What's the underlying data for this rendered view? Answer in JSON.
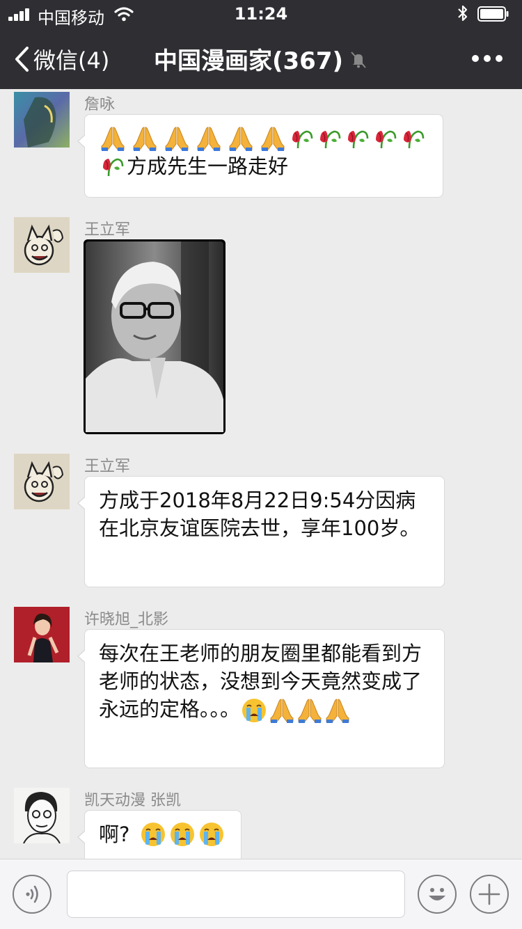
{
  "status_bar": {
    "carrier": "中国移动",
    "time": "11:24"
  },
  "nav": {
    "back_label": "微信(4)",
    "title": "中国漫画家(367)"
  },
  "messages": [
    {
      "sender": "詹咏",
      "text_line1": "",
      "text_line2": "方成先生一路走好"
    },
    {
      "sender": "王立军"
    },
    {
      "sender": "王立军",
      "text": "方成于2018年8月22日9:54分因病在北京友谊医院去世，享年100岁。"
    },
    {
      "sender": "许晓旭_北影",
      "text": "每次在王老师的朋友圈里都能看到方老师的状态，没想到今天竟然变成了永远的定格。。。"
    },
    {
      "sender": "凯天动漫 张凯",
      "text": "啊?"
    }
  ],
  "icons": {
    "pray": "folded-hands-emoji",
    "flower": "wilted-flower-emoji",
    "cry": "crying-face-emoji",
    "voice": "voice-icon",
    "smiley": "smiley-icon",
    "plus": "plus-icon",
    "mute": "mute-bell-icon"
  },
  "colors": {
    "nav_bg": "#2e2e33",
    "chat_bg": "#ececec",
    "bubble_bg": "#ffffff"
  }
}
